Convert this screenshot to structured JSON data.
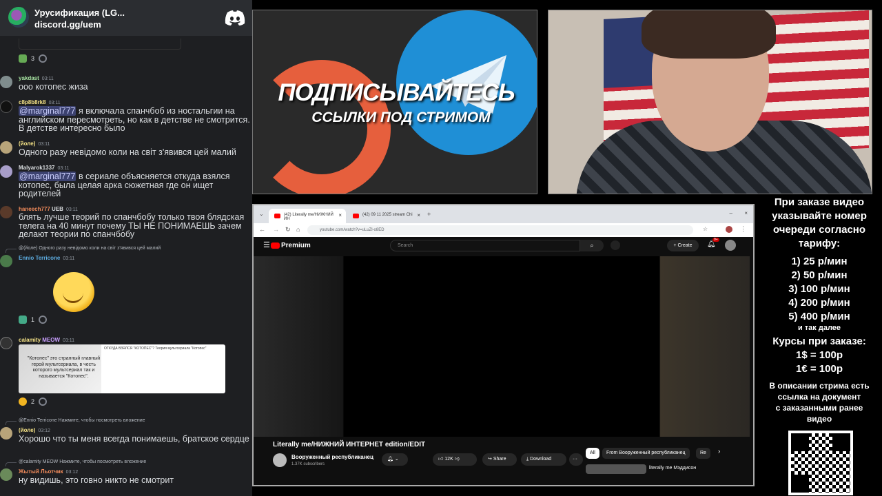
{
  "discord": {
    "server_name": "Урусификация (LG...",
    "server_link": "discord.gg/uem",
    "messages": [
      {
        "user": "yakdast",
        "time": "03:11",
        "text": "ооо котопес жиза",
        "color": "#a6e3a1"
      },
      {
        "user": "c8p8b8rk8",
        "time": "03:11",
        "mention": "@marginal777",
        "text": " я включала спанчбоб из ностальгии на английском пересмотреть, но как в детстве не смотрится. В детстве интересно было",
        "color": "#f4e286"
      },
      {
        "user": "(йоле)",
        "time": "03:11",
        "text": "Одного разу невідомо коли на світ з'явився цей малий",
        "color": "#f4e286"
      },
      {
        "user": "Malyarok1337",
        "time": "03:11",
        "mention": "@marginal777",
        "text": " в сериале объясняется откуда взялся котопес, была целая арка сюжетная где он ищет родителей",
        "color": "#dbdee1"
      },
      {
        "user": "haneech777",
        "badge": "UEB",
        "time": "03:11",
        "text": "блять лучше теорий по спанчбобу только твоя блядская телега на 40 минут почему ТЫ НЕ ПОНИМАЕШЬ зачем делают теории по спанчбобу",
        "color": "#f28b5b"
      },
      {
        "reply": "@(йоле) Одного разу невідомо коли на світ з'явився цей малий",
        "user": "Ennio Terricone",
        "time": "03:11",
        "color": "#5dade2"
      },
      {
        "user": "calamity",
        "badge": "MEOW",
        "time": "03:11",
        "color": "#f4e286"
      },
      {
        "reply": "@Ennio Terricone Нажмите, чтобы посмотреть вложение",
        "user": "(йоле)",
        "time": "03:12",
        "text": "Хорошо что ты меня всегда понимаешь, братское сердце",
        "color": "#f4e286"
      },
      {
        "reply": "@calamity MEOW Нажмите, чтобы посмотреть вложение",
        "user": "Жытый Льотчик",
        "time": "03:12",
        "text": "ну видишь, это говно никто не смотрит",
        "color": "#f28b5b"
      }
    ],
    "reactions": {
      "first": "3",
      "second": "1",
      "third": "2"
    },
    "embed": {
      "title": "ОТКУДА ВЗЯЛСЯ \"КОТОПЕС\"? Теория мультсериала \"Котопес\"",
      "caption": "\"Котопес\" это странный главный герой мультсериала, в честь которого мультсериал так и называется \"Котопес\"."
    }
  },
  "banner": {
    "title": "ПОДПИСЫВАЙТЕСЬ",
    "subtitle": "ССЫЛКИ ПОД СТРИМОМ"
  },
  "browser": {
    "tab1": "(42) Literally me/НИЖНИЙ ИН",
    "tab2": "(42) 09 11 2025 stream Chi",
    "url": "youtube.com/watch?v=uLuZl-o8ED",
    "yt_brand": "Premium",
    "search_placeholder": "Search",
    "create_label": "Create",
    "notif_count": "9+",
    "video_title": "Literally me/НИЖНИЙ ИНТЕРНЕТ edition/EDIT",
    "channel": "Вооруженный республиканец",
    "subscribers": "1.37K subscribers",
    "likes": "12K",
    "share": "Share",
    "download": "Download",
    "chips": [
      "All",
      "From Вооруженный республиканец",
      "Re"
    ],
    "rec_title": "literally me Мэддисон"
  },
  "info": {
    "intro": [
      "При заказе видео",
      "указывайте номер",
      "очереди согласно",
      "тарифу:"
    ],
    "prices": [
      "1) 25 р/мин",
      "2) 50 р/мин",
      "3) 100 р/мин",
      "4) 200 р/мин",
      "5) 400 р/мин"
    ],
    "etc": "и так далее",
    "rates_title": "Курсы при заказе:",
    "rates": [
      "1$ = 100р",
      "1€ = 100р"
    ],
    "doc_text": [
      "В описании стрима есть",
      "ссылка на документ",
      "с заказанными ранее",
      "видео"
    ]
  }
}
